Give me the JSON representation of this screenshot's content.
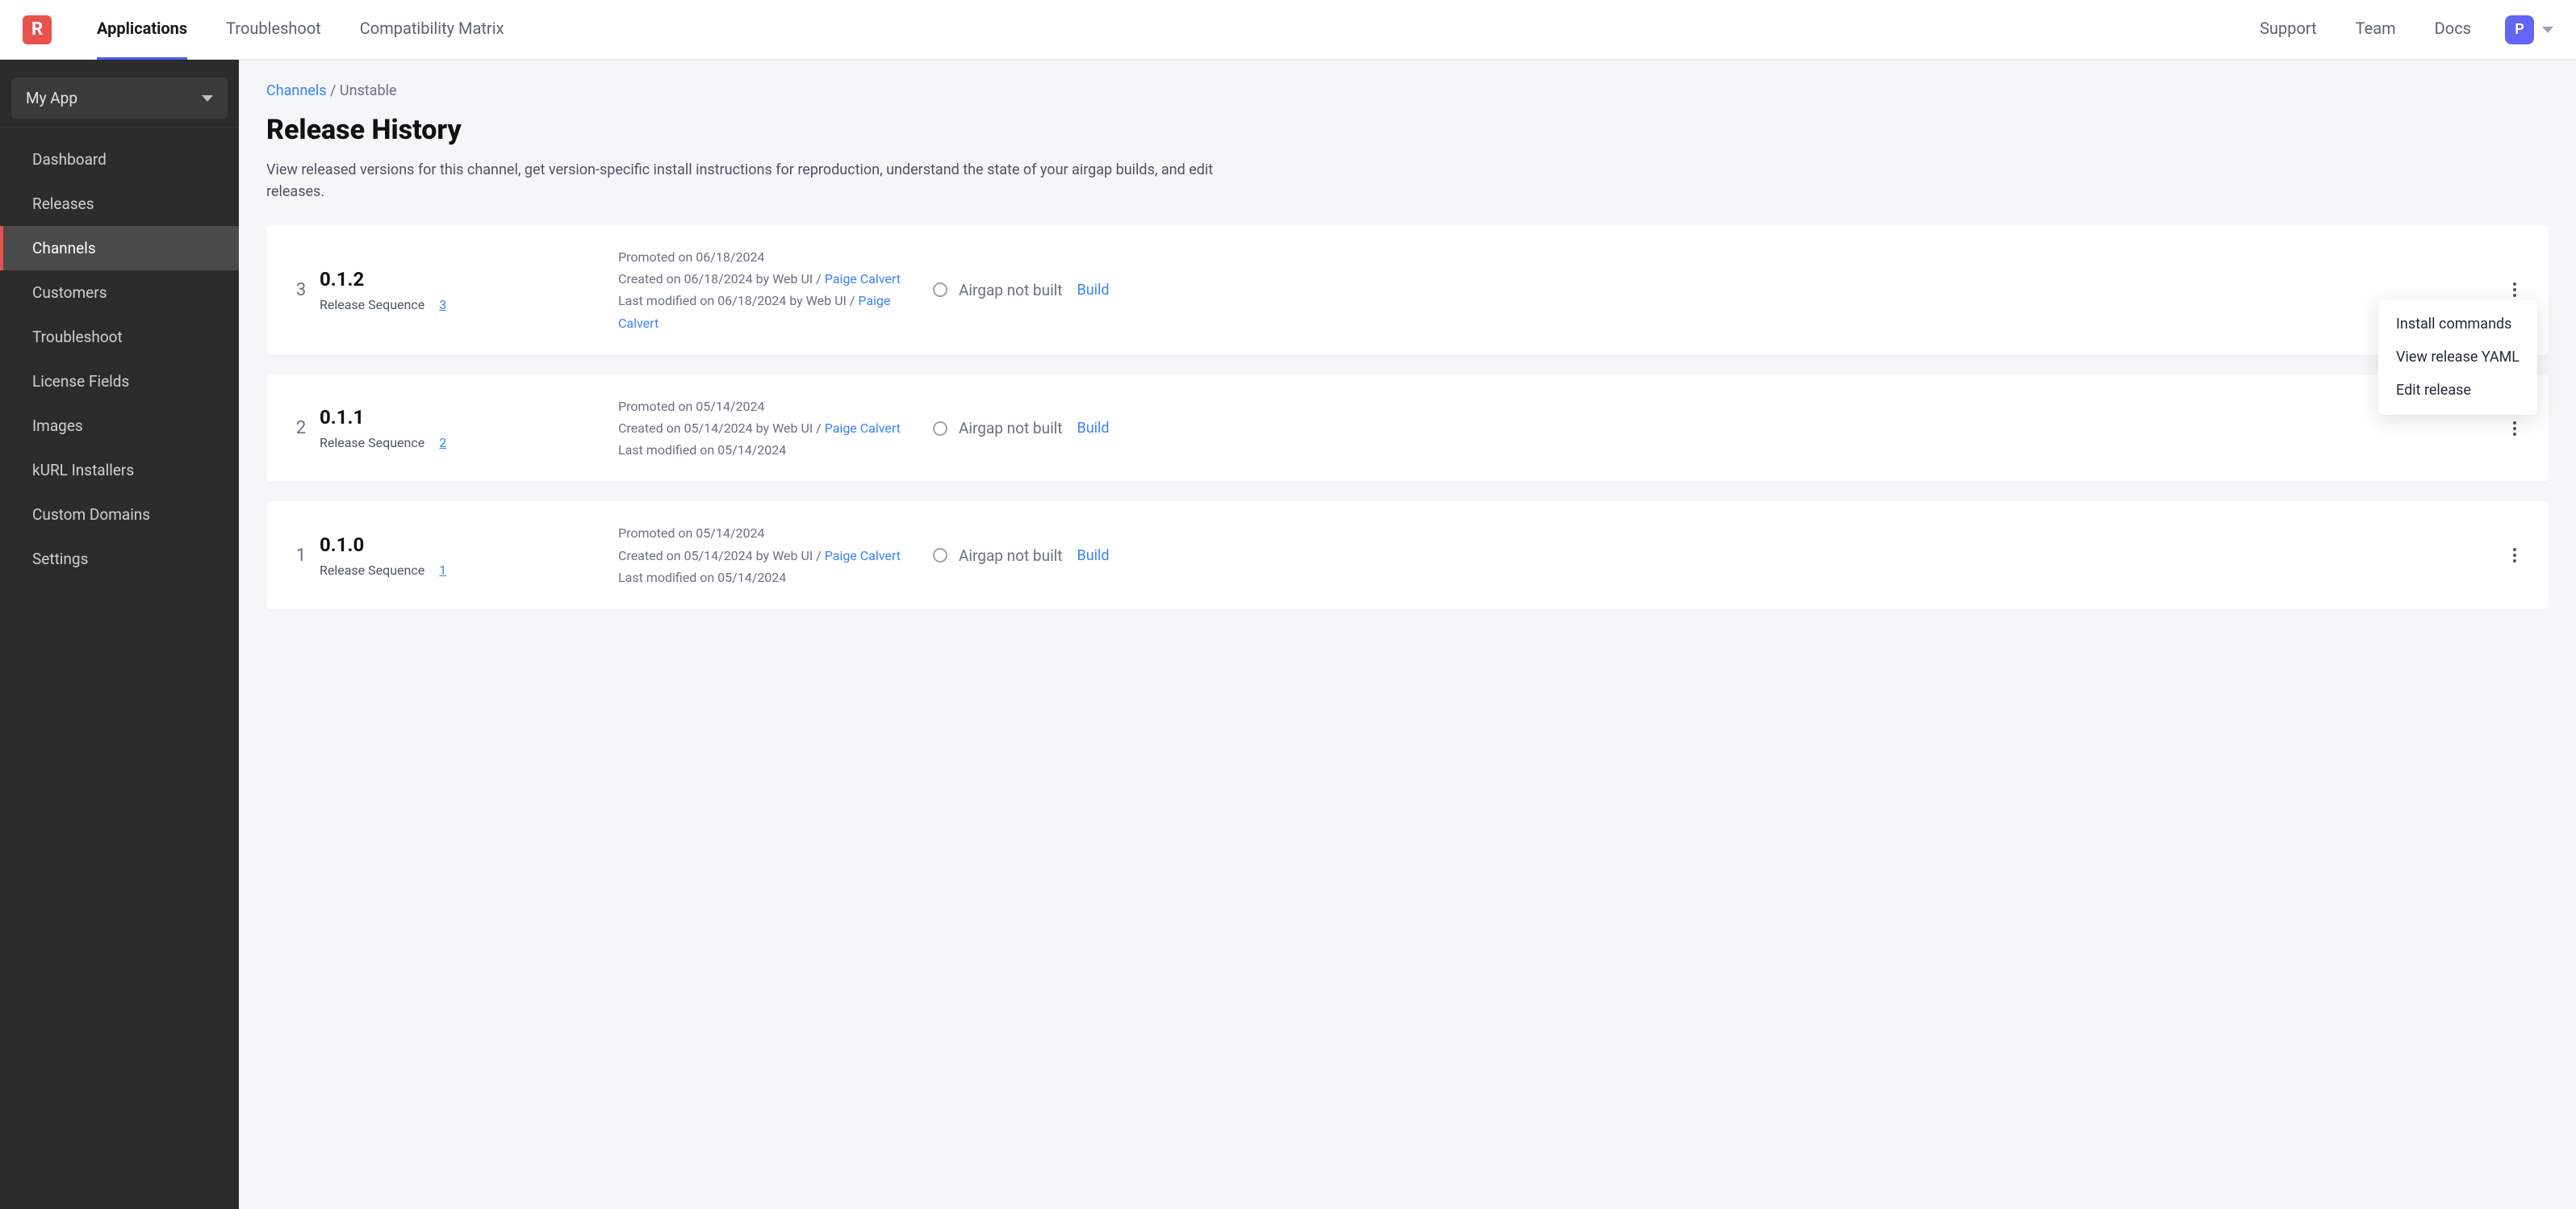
{
  "logo_letter": "R",
  "topnav": {
    "left": [
      {
        "label": "Applications",
        "active": true
      },
      {
        "label": "Troubleshoot",
        "active": false
      },
      {
        "label": "Compatibility Matrix",
        "active": false
      }
    ],
    "right": [
      {
        "label": "Support"
      },
      {
        "label": "Team"
      },
      {
        "label": "Docs"
      }
    ],
    "avatar_letter": "P"
  },
  "sidebar": {
    "app_name": "My App",
    "items": [
      {
        "label": "Dashboard",
        "active": false
      },
      {
        "label": "Releases",
        "active": false
      },
      {
        "label": "Channels",
        "active": true
      },
      {
        "label": "Customers",
        "active": false
      },
      {
        "label": "Troubleshoot",
        "active": false
      },
      {
        "label": "License Fields",
        "active": false
      },
      {
        "label": "Images",
        "active": false
      },
      {
        "label": "kURL Installers",
        "active": false
      },
      {
        "label": "Custom Domains",
        "active": false
      },
      {
        "label": "Settings",
        "active": false
      }
    ]
  },
  "breadcrumb": {
    "root": "Channels",
    "sep": "/",
    "current": "Unstable"
  },
  "page": {
    "title": "Release History",
    "subhead": "View released versions for this channel, get version-specific install instructions for reproduction, understand the state of your airgap builds, and edit releases."
  },
  "labels": {
    "release_sequence": "Release Sequence",
    "airgap_not_built": "Airgap not built",
    "build": "Build"
  },
  "context_menu": [
    "Install commands",
    "View release YAML",
    "Edit release"
  ],
  "releases": [
    {
      "seq_display": "3",
      "version": "0.1.2",
      "seq_num": "3",
      "promoted": "Promoted on 06/18/2024",
      "created_prefix": "Created on 06/18/2024 by Web UI / ",
      "created_user": "Paige Calvert",
      "modified_prefix": "Last modified on 06/18/2024 by Web UI / ",
      "modified_user": "Paige Calvert",
      "menu_open": true
    },
    {
      "seq_display": "2",
      "version": "0.1.1",
      "seq_num": "2",
      "promoted": "Promoted on 05/14/2024",
      "created_prefix": "Created on 05/14/2024 by Web UI / ",
      "created_user": "Paige Calvert",
      "modified_prefix": "Last modified on 05/14/2024",
      "modified_user": "",
      "menu_open": false
    },
    {
      "seq_display": "1",
      "version": "0.1.0",
      "seq_num": "1",
      "promoted": "Promoted on 05/14/2024",
      "created_prefix": "Created on 05/14/2024 by Web UI / ",
      "created_user": "Paige Calvert",
      "modified_prefix": "Last modified on 05/14/2024",
      "modified_user": "",
      "menu_open": false
    }
  ]
}
